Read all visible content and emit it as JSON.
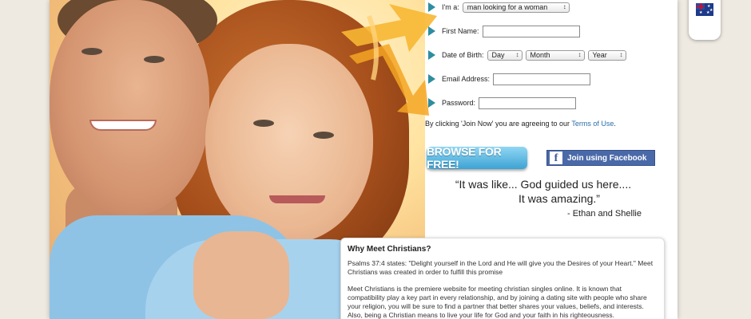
{
  "colors": {
    "accent": "#2e8da1",
    "link": "#2a6ea8",
    "browse_button": "#3ea3d3",
    "facebook": "#4a69a8"
  },
  "signup": {
    "im_a_label": "I'm a:",
    "im_a_value": "man looking for a woman",
    "first_name_label": "First Name:",
    "first_name_value": "",
    "dob_label": "Date of Birth:",
    "dob_day": "Day",
    "dob_month": "Month",
    "dob_year": "Year",
    "email_label": "Email Address:",
    "email_value": "",
    "password_label": "Password:",
    "password_value": "",
    "terms_prefix": "By clicking 'Join Now' you are agreeing to our ",
    "terms_link": "Terms of Use",
    "terms_suffix": ".",
    "browse_button": "BROWSE FOR FREE!",
    "facebook_button": "Join using Facebook",
    "facebook_icon": "f"
  },
  "testimonial": {
    "line1": "“It was like... God guided us here....",
    "line2": "It was  amazing.”",
    "author": "- Ethan and Shellie"
  },
  "why": {
    "title": "Why Meet Christians?",
    "p1": "Psalms 37:4 states: \"Delight yourself in the Lord and He will give you the Desires of your Heart.\" Meet Christians was created in order to fulfill this promise",
    "p2": "Meet Christians is the premiere website for meeting christian singles online. It is known that compatibility play a key part in every relationship, and by joining a dating site with people who share your religion, you will be sure to find a partner that better shares your values, beliefs, and interests. Also, being a Christian means to live your life for God and your faith in his righteousness."
  },
  "icons": [
    "play-arrow-icon",
    "australia-flag-icon",
    "facebook-icon",
    "arrows-graphic"
  ]
}
